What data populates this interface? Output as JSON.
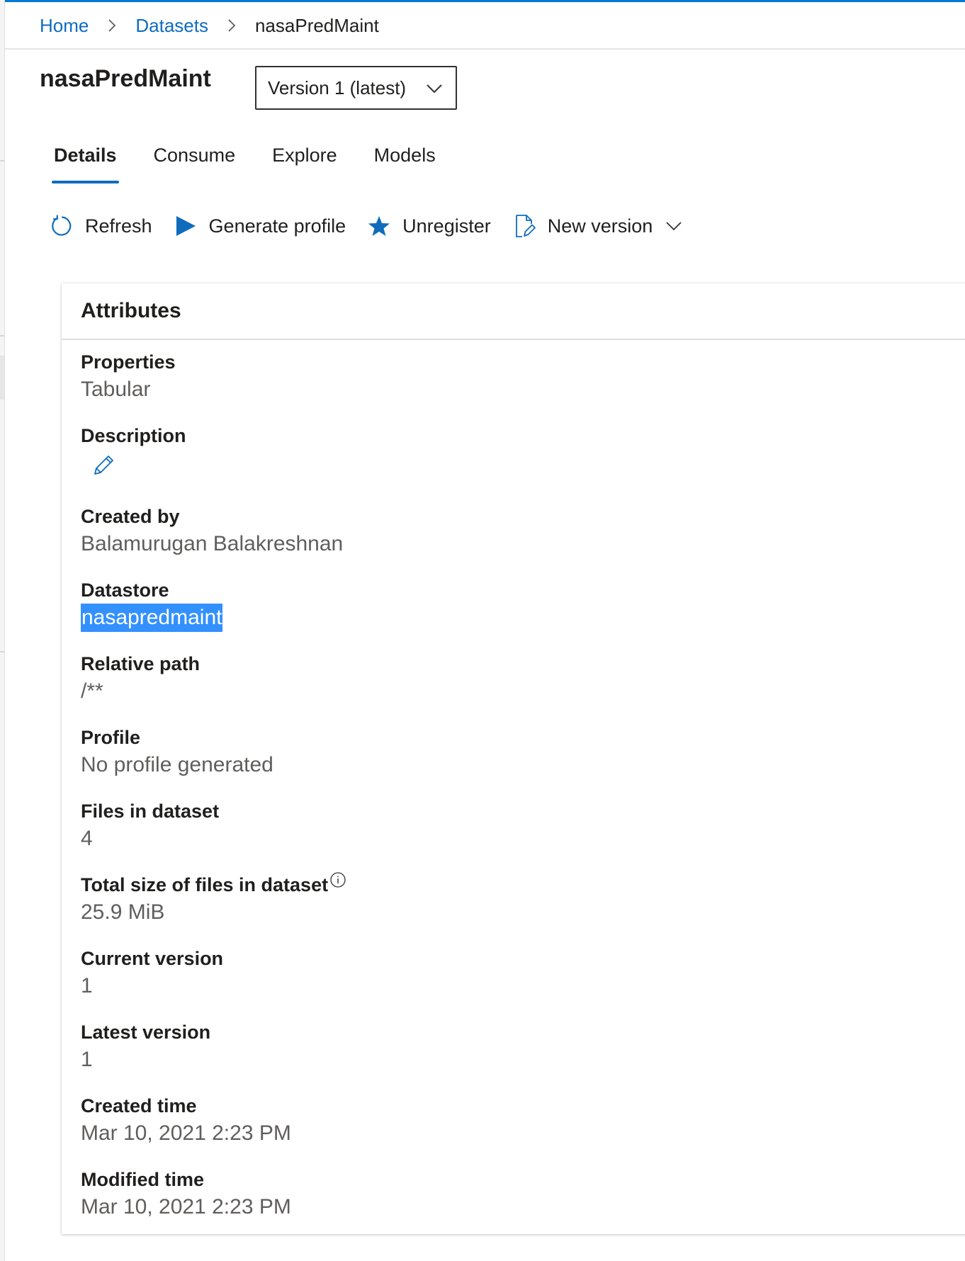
{
  "breadcrumb": {
    "home": "Home",
    "datasets": "Datasets",
    "current": "nasaPredMaint"
  },
  "header": {
    "title": "nasaPredMaint",
    "version_select": "Version 1 (latest)"
  },
  "tabs": [
    {
      "label": "Details",
      "active": true
    },
    {
      "label": "Consume",
      "active": false
    },
    {
      "label": "Explore",
      "active": false
    },
    {
      "label": "Models",
      "active": false
    }
  ],
  "toolbar": {
    "refresh": {
      "label": "Refresh",
      "icon": "refresh-icon"
    },
    "generate_profile": {
      "label": "Generate profile",
      "icon": "play-icon"
    },
    "unregister": {
      "label": "Unregister",
      "icon": "star-icon"
    },
    "new_version": {
      "label": "New version",
      "icon": "document-edit-icon"
    }
  },
  "attributes": {
    "title": "Attributes",
    "properties": {
      "label": "Properties",
      "value": "Tabular"
    },
    "description": {
      "label": "Description"
    },
    "created_by": {
      "label": "Created by",
      "value": "Balamurugan Balakreshnan"
    },
    "datastore": {
      "label": "Datastore",
      "value": "nasapredmaint"
    },
    "relative_path": {
      "label": "Relative path",
      "value": "/**"
    },
    "profile": {
      "label": "Profile",
      "value": "No profile generated"
    },
    "files_in_dataset": {
      "label": "Files in dataset",
      "value": "4"
    },
    "total_size": {
      "label": "Total size of files in dataset",
      "value": "25.9 MiB"
    },
    "current_version": {
      "label": "Current version",
      "value": "1"
    },
    "latest_version": {
      "label": "Latest version",
      "value": "1"
    },
    "created_time": {
      "label": "Created time",
      "value": "Mar 10, 2021 2:23 PM"
    },
    "modified_time": {
      "label": "Modified time",
      "value": "Mar 10, 2021 2:23 PM"
    }
  },
  "colors": {
    "accent": "#0f6cbd",
    "selection": "#3390ff",
    "secondary_text": "#605e5c"
  }
}
